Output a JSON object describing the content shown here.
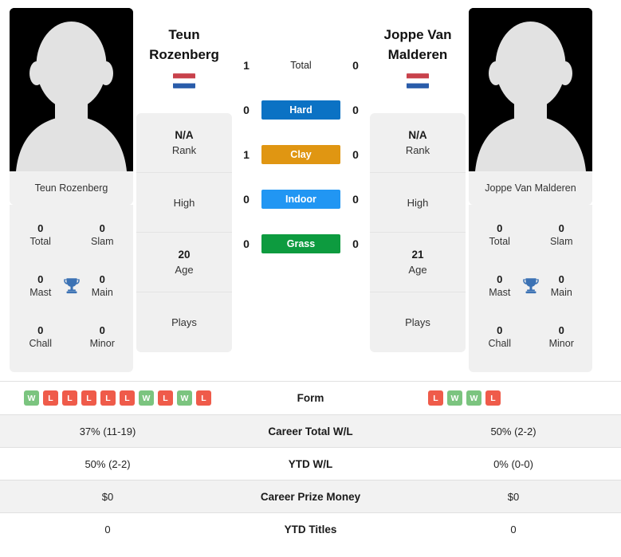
{
  "players": {
    "left": {
      "name": "Teun Rozenberg",
      "name_line1": "Teun",
      "name_line2": "Rozenberg",
      "photo_caption": "Teun Rozenberg",
      "flag": "netherlands-flag",
      "rank_value": "N/A",
      "rank_label": "Rank",
      "high_label": "High",
      "age_value": "20",
      "age_label": "Age",
      "plays_label": "Plays",
      "titles": [
        {
          "value": "0",
          "label": "Total"
        },
        {
          "value": "0",
          "label": "Slam"
        },
        {
          "value": "0",
          "label": "Mast"
        },
        {
          "value": "0",
          "label": "Main"
        },
        {
          "value": "0",
          "label": "Chall"
        },
        {
          "value": "0",
          "label": "Minor"
        }
      ],
      "form": [
        "W",
        "L",
        "L",
        "L",
        "L",
        "L",
        "W",
        "L",
        "W",
        "L"
      ],
      "career_total_wl": "37% (11-19)",
      "ytd_wl": "50% (2-2)",
      "career_prize_money": "$0",
      "ytd_titles": "0"
    },
    "right": {
      "name": "Joppe Van Malderen",
      "name_line1": "Joppe Van",
      "name_line2": "Malderen",
      "photo_caption": "Joppe Van Malderen",
      "flag": "netherlands-flag",
      "rank_value": "N/A",
      "rank_label": "Rank",
      "high_label": "High",
      "age_value": "21",
      "age_label": "Age",
      "plays_label": "Plays",
      "titles": [
        {
          "value": "0",
          "label": "Total"
        },
        {
          "value": "0",
          "label": "Slam"
        },
        {
          "value": "0",
          "label": "Mast"
        },
        {
          "value": "0",
          "label": "Main"
        },
        {
          "value": "0",
          "label": "Chall"
        },
        {
          "value": "0",
          "label": "Minor"
        }
      ],
      "form": [
        "L",
        "W",
        "W",
        "L"
      ],
      "career_total_wl": "50% (2-2)",
      "ytd_wl": "0% (0-0)",
      "career_prize_money": "$0",
      "ytd_titles": "0"
    }
  },
  "h2h": {
    "rows": [
      {
        "label": "Total",
        "left": "1",
        "right": "0",
        "color": null,
        "style": "plain"
      },
      {
        "label": "Hard",
        "left": "0",
        "right": "0",
        "color": "#0b72c4",
        "style": "badge"
      },
      {
        "label": "Clay",
        "left": "1",
        "right": "0",
        "color": "#e09612",
        "style": "badge"
      },
      {
        "label": "Indoor",
        "left": "0",
        "right": "0",
        "color": "#2196f3",
        "style": "badge"
      },
      {
        "label": "Grass",
        "left": "0",
        "right": "0",
        "color": "#0d9b3f",
        "style": "badge"
      }
    ]
  },
  "stats_table": {
    "rows": [
      {
        "label": "Form",
        "key": "form",
        "type": "form",
        "shaded": false
      },
      {
        "label": "Career Total W/L",
        "key": "career_total_wl",
        "type": "text",
        "shaded": true
      },
      {
        "label": "YTD W/L",
        "key": "ytd_wl",
        "type": "text",
        "shaded": false
      },
      {
        "label": "Career Prize Money",
        "key": "career_prize_money",
        "type": "text",
        "shaded": true
      },
      {
        "label": "YTD Titles",
        "key": "ytd_titles",
        "type": "text",
        "shaded": false
      }
    ]
  },
  "colors": {
    "win": "#7bc47f",
    "loss": "#ef5b4a",
    "hard": "#0b72c4",
    "clay": "#e09612",
    "indoor": "#2196f3",
    "grass": "#0d9b3f",
    "trophy": "#3c72b4",
    "flag_red": "#c8414b",
    "flag_blue": "#2a5caa"
  }
}
